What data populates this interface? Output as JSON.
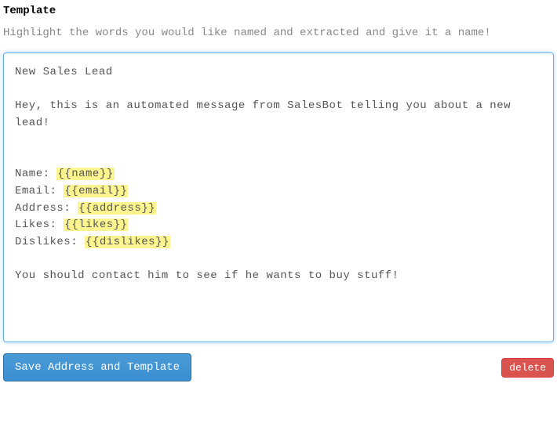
{
  "heading": "Template",
  "helper_text": "Highlight the words you would like named and extracted and give it a name!",
  "template": {
    "line1": "New Sales Lead",
    "greeting_l1": "Hey, this is an automated message from SalesBot telling you about a new",
    "greeting_l2": "lead!",
    "name_label": "Name: ",
    "name_token": "{{name}}",
    "email_label": "Email: ",
    "email_token": "{{email}}",
    "address_label": "Address: ",
    "address_token": "{{address}}",
    "likes_label": "Likes: ",
    "likes_token": "{{likes}}",
    "dislikes_label": "Dislikes: ",
    "dislikes_token": "{{dislikes}}",
    "closing": "You should contact him to see if he wants to buy stuff!"
  },
  "buttons": {
    "save_label": "Save Address and Template",
    "delete_label": "delete"
  }
}
